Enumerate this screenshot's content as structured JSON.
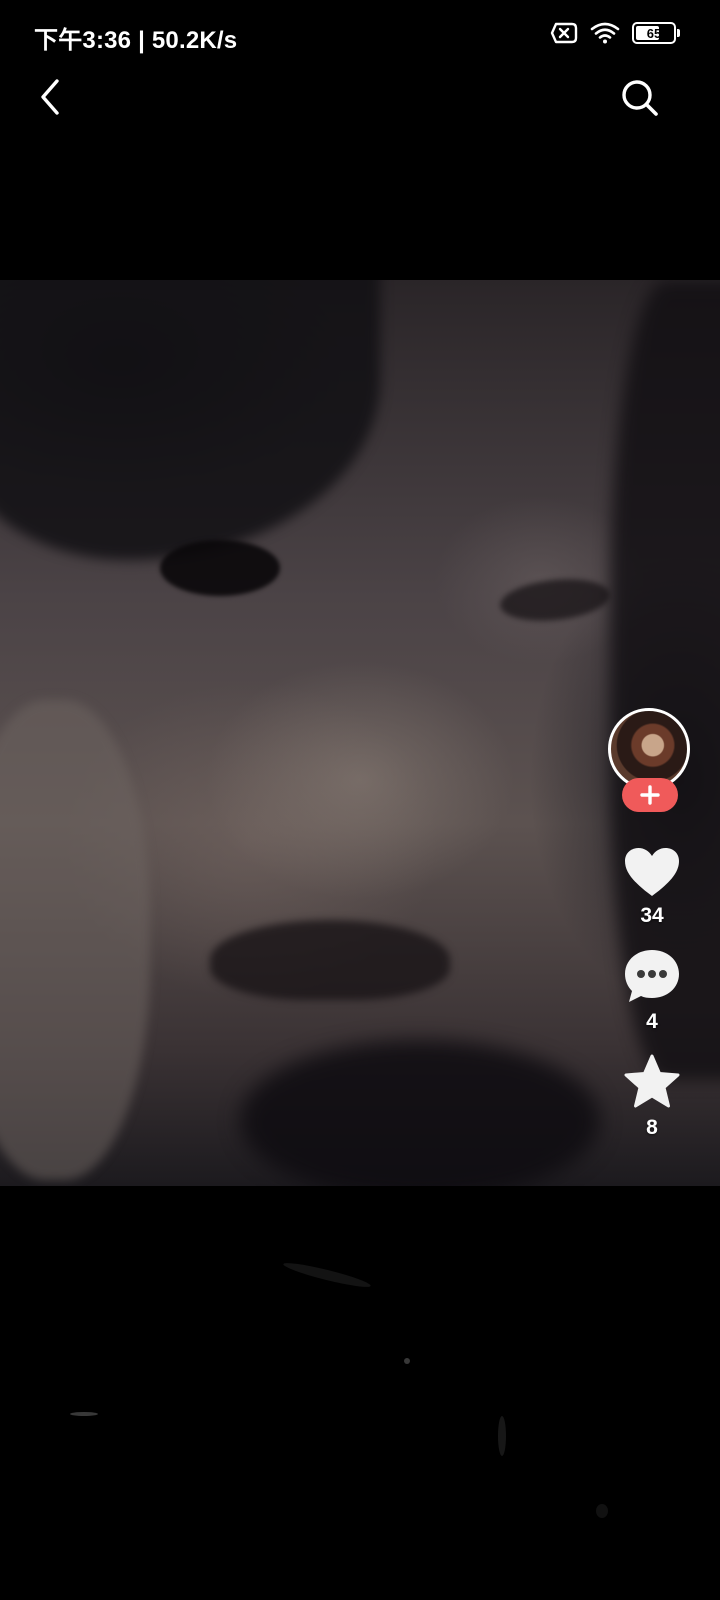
{
  "status_bar": {
    "time_speed": "下午3:36 | 50.2K/s",
    "battery_level": "65",
    "battery_percent": 65,
    "icons": [
      "sim-off-icon",
      "wifi-icon",
      "battery-icon"
    ]
  },
  "nav": {
    "back_icon": "chevron-left-icon",
    "search_icon": "search-icon"
  },
  "actions": {
    "follow_icon": "plus-icon",
    "like_count": "34",
    "comment_count": "4",
    "favorite_count": "8"
  },
  "colors": {
    "background": "#000000",
    "follow_button": "#f05a5a",
    "icon": "#ffffff"
  }
}
